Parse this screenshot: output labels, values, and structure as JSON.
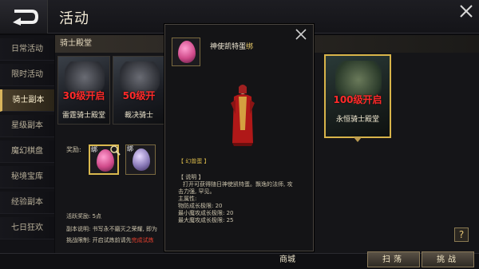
{
  "header": {
    "title": "活动"
  },
  "tabs": [
    {
      "label": "日常活动"
    },
    {
      "label": "限时活动"
    },
    {
      "label": "骑士副本"
    },
    {
      "label": "星级副本"
    },
    {
      "label": "魔幻棋盘"
    },
    {
      "label": "秘境宝库"
    },
    {
      "label": "经验副本"
    },
    {
      "label": "七日狂欢"
    }
  ],
  "section": {
    "title": "骑士殿堂"
  },
  "cards": [
    {
      "level": "30级开启",
      "name": "雷霆骑士殿堂"
    },
    {
      "level": "50级开",
      "name": "裁决骑士"
    },
    {
      "level": "100级开启",
      "name": "永恒骑士殿堂"
    }
  ],
  "rewards": {
    "label": "奖励:",
    "items": [
      {
        "bind": "绑",
        "color": "#d04a8a"
      },
      {
        "bind": "绑",
        "color": "#8a7ab8"
      }
    ]
  },
  "info": {
    "activity": "活跃奖励: 5点",
    "desc": "副本说明: 书写永不磨灭之荣耀, 即为",
    "limit_prefix": "挑战限制: 开启试炼前请先",
    "limit_red": "完成试炼"
  },
  "popup": {
    "title": "神使凯特蛋",
    "title_bind": "绑",
    "tag": "【 幻兽蛋 】",
    "desc_header": "【 说明 】",
    "desc_lines": [
      "打开可获得随日神使凯特蛋。飘逸的法师, 攻",
      "击力强, 罕见。",
      "主属性:",
      "物防成长极限: 20",
      "最小魔攻成长极限: 20",
      "最大魔攻成长极限: 25"
    ]
  },
  "footer": {
    "shop": "商城",
    "sweep": "扫荡",
    "challenge": "挑战"
  },
  "colors": {
    "gold": "#d8b44a",
    "level_red": "#ff2a2a",
    "egg_pink": "#d04a8a"
  }
}
